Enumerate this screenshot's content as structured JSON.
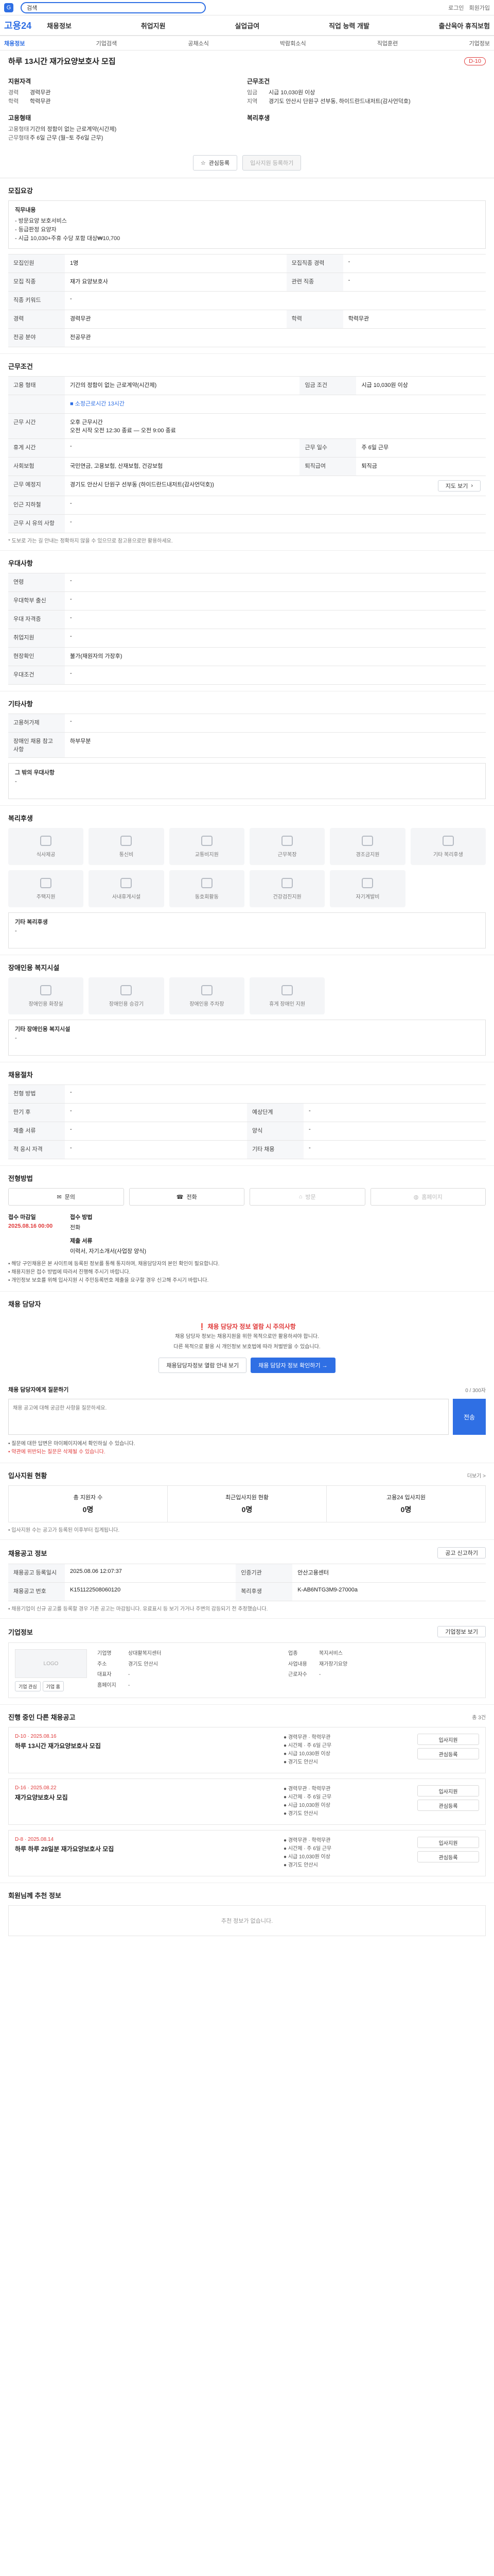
{
  "top": {
    "search_placeholder": "",
    "search_value": "검색",
    "util": [
      "로그인",
      "회원가입"
    ]
  },
  "brand": "고용24",
  "gnb": [
    "채용정보",
    "취업지원",
    "실업급여",
    "직업 능력 개발",
    "출산육아 휴직보험"
  ],
  "subnav": [
    "채용정보",
    "기업검색",
    "공채소식",
    "박람회소식",
    "직업훈련",
    "기업정보"
  ],
  "job": {
    "title": "하루 13시간 재가요양보호사 모집",
    "dday": "D-10",
    "summary": {
      "left_title": "지원자격",
      "left": [
        {
          "k": "경력",
          "v": "경력무관"
        },
        {
          "k": "학력",
          "v": "학력무관"
        }
      ],
      "right_title": "근무조건",
      "right": [
        {
          "k": "임금",
          "v": "시급 10,030원 이상"
        },
        {
          "k": "지역",
          "v": "경기도 안산시 단원구 선부동, 하이드란드내저트(감사언덕호)"
        }
      ],
      "mid_title": "고용형태",
      "mid": [
        {
          "k": "고용형태",
          "v": "기간의 정함이 없는 근로계약(시간제)"
        },
        {
          "k": "근무형태",
          "v": "주 6일 근무 (월~토 주6일 근무)"
        }
      ],
      "welfare_title": "복리후생"
    },
    "actions": {
      "scrap": "관심등록",
      "apply": "입사지원 등록하기"
    }
  },
  "recruit": {
    "title": "모집요강",
    "content_label": "직무내용",
    "content_lines": [
      "- 방문요양 보호서비스",
      "- 등급판정 요양자",
      "- 시급 10,030+주휴 수당 포함 대상₩10,700"
    ],
    "rows": [
      {
        "k1": "모집인원",
        "v1": "1명",
        "k2": "모집직종 경력",
        "v2": "-"
      },
      {
        "k1": "모집 직종",
        "v1": "재가 요양보호사",
        "k2": "관련 직종",
        "v2": "-"
      },
      {
        "k1": "직종 키워드",
        "v1": "-",
        "k2": "",
        "v2": ""
      },
      {
        "k1": "경력",
        "v1": "경력무관",
        "k2": "학력",
        "v2": "학력무관"
      },
      {
        "k1": "전공 분야",
        "v1": "전공무관",
        "k2": "",
        "v2": ""
      }
    ]
  },
  "conditions": {
    "title": "근무조건",
    "rows": [
      {
        "k1": "고용 형태",
        "v1": "기간의 정함이 없는 근로계약(시간제)",
        "k2": "임금 조건",
        "v2": "시급 10,030원 이상"
      },
      {
        "k1": "",
        "v1": "■ 소정근로시간 13시간",
        "k2": "",
        "v2": ""
      },
      {
        "k1": "근무 시간",
        "v1": "오후 근무시간\n오전 시작 오전 12:30 종료 — 오전 9:00 종료",
        "k2": "",
        "v2": ""
      },
      {
        "k1": "휴게 시간",
        "v1": "-",
        "k2": "근무 일수",
        "v2": "주 6일 근무"
      },
      {
        "k1": "사회보험",
        "v1": "국민연금, 고용보험, 산재보험, 건강보험",
        "k2": "퇴직급여",
        "v2": "퇴직금"
      },
      {
        "k1": "근무 예정지",
        "v1": "경기도 안산시 단원구 선부동 (하이드란드내저트(감사언덕호))",
        "k2": "",
        "v2": ""
      },
      {
        "k1": "인근 지하철",
        "v1": "-",
        "k2": "",
        "v2": ""
      },
      {
        "k1": "근무 시 유의 사항",
        "v1": "-",
        "k2": "",
        "v2": ""
      }
    ],
    "map_button": "지도 보기",
    "note": "* 도보로 가는 길 안내는 정확하지 않을 수 있으므로 참고용으로만 활용하세요."
  },
  "preference": {
    "title": "우대사항",
    "rows": [
      {
        "k": "연령",
        "v": "-"
      },
      {
        "k": "우대학부 출신",
        "v": "-"
      },
      {
        "k": "우대 자격증",
        "v": "-"
      },
      {
        "k": "취업지원",
        "v": "-"
      },
      {
        "k": "현장확인",
        "v": "불가(재원자의 가장후)"
      },
      {
        "k": "우대조건",
        "v": "-"
      }
    ]
  },
  "other": {
    "title": "기타사항",
    "rows": [
      {
        "k": "고용허가제",
        "v": "-"
      },
      {
        "k": "장애인 채용 참고 사항",
        "v": "하부무분"
      }
    ],
    "extra_label": "그 밖의 우대사항",
    "extra_value": "-"
  },
  "welfare": {
    "title": "복리후생",
    "items": [
      "식사제공",
      "통신비",
      "교통비지원",
      "근무복장",
      "경조금지원",
      "기타 복리후생",
      "주택지원",
      "사내휴게시설",
      "동호회활동",
      "건강검진지원",
      "자기계발비"
    ],
    "extra_label": "기타 복리후생",
    "extra_value": "-"
  },
  "disability": {
    "title": "장애인용 복지시설",
    "items": [
      "장애인용 화장실",
      "장애인용 승강기",
      "장애인용 주차장",
      "휴게 장애인 지원"
    ],
    "extra_label": "기타 장애인용 복지시설",
    "extra_value": "-"
  },
  "hiring": {
    "title": "채용절차",
    "rows": [
      {
        "k1": "전형 방법",
        "v1": "-",
        "k2": "",
        "v2": ""
      },
      {
        "k1": "만기 후",
        "v1": "-",
        "k2": "예상단계",
        "v2": "-"
      },
      {
        "k1": "제출 서류",
        "v1": "-",
        "k2": "양식",
        "v2": "-"
      },
      {
        "k1": "적 응시 자격",
        "v1": "-",
        "k2": "기타 채용",
        "v2": "-"
      }
    ]
  },
  "apply": {
    "title": "전형방법",
    "methods": [
      "문의",
      "전화",
      "방문",
      "홈페이지"
    ],
    "period_label": "접수 마감일",
    "period_value": "2025.08.16 00:00",
    "method_label": "접수 방법",
    "method_value": "전화",
    "doc_label": "제출 서류",
    "doc_value": "이력서, 자기소개서(사업장 양식)",
    "bullets": [
      "• 해당 구인채용은 본 사이트에 등록된 정보를 통해 통지하며, 채용담당자의 본인 확인이 필요합니다.",
      "• 채용지원은 접수 방법에 따라서 진행해 주시기 바랍니다.",
      "• 개인정보 보호를 위해 입사지원 시 주민등록번호 제출을 요구할 경우 신고해 주시기 바랍니다."
    ]
  },
  "contact": {
    "title": "채용 담당자",
    "warn": "❗ 채용 담당자 정보 열람 시 주의사항",
    "lines": [
      "채용 담당자 정보는 채용지원을 위한 목적으로만 활용하셔야 합니다.",
      "다른 목적으로 활용 시 개인정보 보호법에 따라 처벌받을 수 있습니다."
    ],
    "btn_view": "채용담당자정보 열람 안내 보기",
    "btn_check": "채용 담당자 정보 확인하기 →",
    "qna_label": "채용 담당자에게 질문하기",
    "qna_counter": "0 / 300자",
    "qna_placeholder": "채용 공고에 대해 궁금한 사항을 질문하세요.",
    "qna_send": "전송",
    "qna_notes": [
      "• 질문에 대한 답변은 마이페이지에서 확인하실 수 있습니다.",
      "• 약관에 위반되는 질문은 삭제될 수 있습니다."
    ]
  },
  "stats": {
    "title": "입사지원 현황",
    "more": "더보기 >",
    "items": [
      {
        "label": "총 지원자 수",
        "value": "0명"
      },
      {
        "label": "최근입사지원 현황",
        "value": "0명"
      },
      {
        "label": "고용24 입사지원",
        "value": "0명"
      }
    ],
    "note": "• 입사지원 수는 공고가 등록된 이후부터 집계됩니다."
  },
  "reg": {
    "title": "채용공고 정보",
    "btn": "공고 신고하기",
    "rows": [
      {
        "k1": "채용공고 등록일시",
        "v1": "2025.08.06 12:07:37",
        "k2": "인증기관",
        "v2": "안산고용센터"
      },
      {
        "k1": "채용공고 번호",
        "v1": "K151122508060120",
        "k2": "복리후생",
        "v2": "K-AB6NTG3M9-27000a"
      }
    ],
    "note": "• 채용기업이 신규 공고를 등록할 경우 기존 공고는 마감됩니다. 유료표시 등 보기 가거나 주변의 감등되기 전 추정했습니다."
  },
  "company": {
    "title": "기업정보",
    "btn": "기업정보 보기",
    "rows": [
      {
        "k": "기업명",
        "v": "상대활복지센터",
        "k2": "업종",
        "v2": "복지서비스"
      },
      {
        "k": "주소",
        "v": "경기도 안산시",
        "k2": "사업내용",
        "v2": "재가장기요양"
      },
      {
        "k": "대표자",
        "v": "-",
        "k2": "근로자수",
        "v2": "-"
      },
      {
        "k": "홈페이지",
        "v": "-",
        "k2": "",
        "v2": ""
      }
    ],
    "btn_a": "기업 관심",
    "btn_b": "기업 홈"
  },
  "related": {
    "title": "진행 중인 다른 채용공고",
    "sub": "총 3건",
    "items": [
      {
        "dday": "D-10 · 2025.08.16",
        "title": "하루 13시간 재가요양보호사 모집",
        "meta": [
          "● 경력무관 · 학력무관",
          "● 시간제 · 주 6일 근무",
          "● 시급 10,030원 이상",
          "● 경기도 안산시"
        ],
        "b1": "입사지원",
        "b2": "관심등록"
      },
      {
        "dday": "D-16 · 2025.08.22",
        "title": "재가요양보호사 모집",
        "meta": [
          "● 경력무관 · 학력무관",
          "● 시간제 · 주 6일 근무",
          "● 시급 10,030원 이상",
          "● 경기도 안산시"
        ],
        "b1": "입사지원",
        "b2": "관심등록"
      },
      {
        "dday": "D-8 · 2025.08.14",
        "title": "하루 하루 28일분 재가요양보호사 모집",
        "meta": [
          "● 경력무관 · 학력무관",
          "● 시간제 · 주 6일 근무",
          "● 시급 10,030원 이상",
          "● 경기도 안산시"
        ],
        "b1": "입사지원",
        "b2": "관심등록"
      }
    ]
  },
  "recommend": {
    "title": "회원님께 추천 정보",
    "empty": "추천 정보가 없습니다."
  }
}
